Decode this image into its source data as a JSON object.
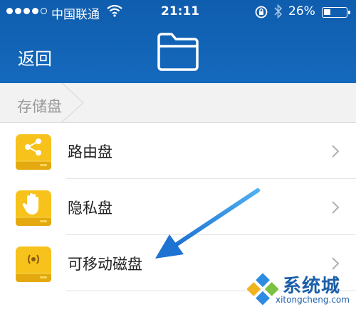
{
  "status_bar": {
    "carrier": "中国联通",
    "time": "21:11",
    "battery_percent": "26%",
    "signal_bars_filled": 4,
    "signal_bars_total": 5,
    "battery_level": 0.26,
    "icons": [
      "signal-dots-icon",
      "wifi-icon",
      "rotation-lock-icon",
      "bluetooth-icon",
      "battery-icon"
    ]
  },
  "nav": {
    "back_label": "返回",
    "title_icon": "folder-icon"
  },
  "breadcrumb": {
    "current": "存储盘"
  },
  "drives": [
    {
      "label": "路由盘",
      "icon": "share-icon"
    },
    {
      "label": "隐私盘",
      "icon": "hand-icon"
    },
    {
      "label": "可移动磁盘",
      "icon": "wireless-icon"
    }
  ],
  "colors": {
    "header_blue": "#1465b6",
    "drive_yellow": "#f6c21b",
    "annotation_arrow": "#2a8fe0"
  },
  "watermark": {
    "text": "系统城",
    "url": "xitongcheng.com"
  }
}
